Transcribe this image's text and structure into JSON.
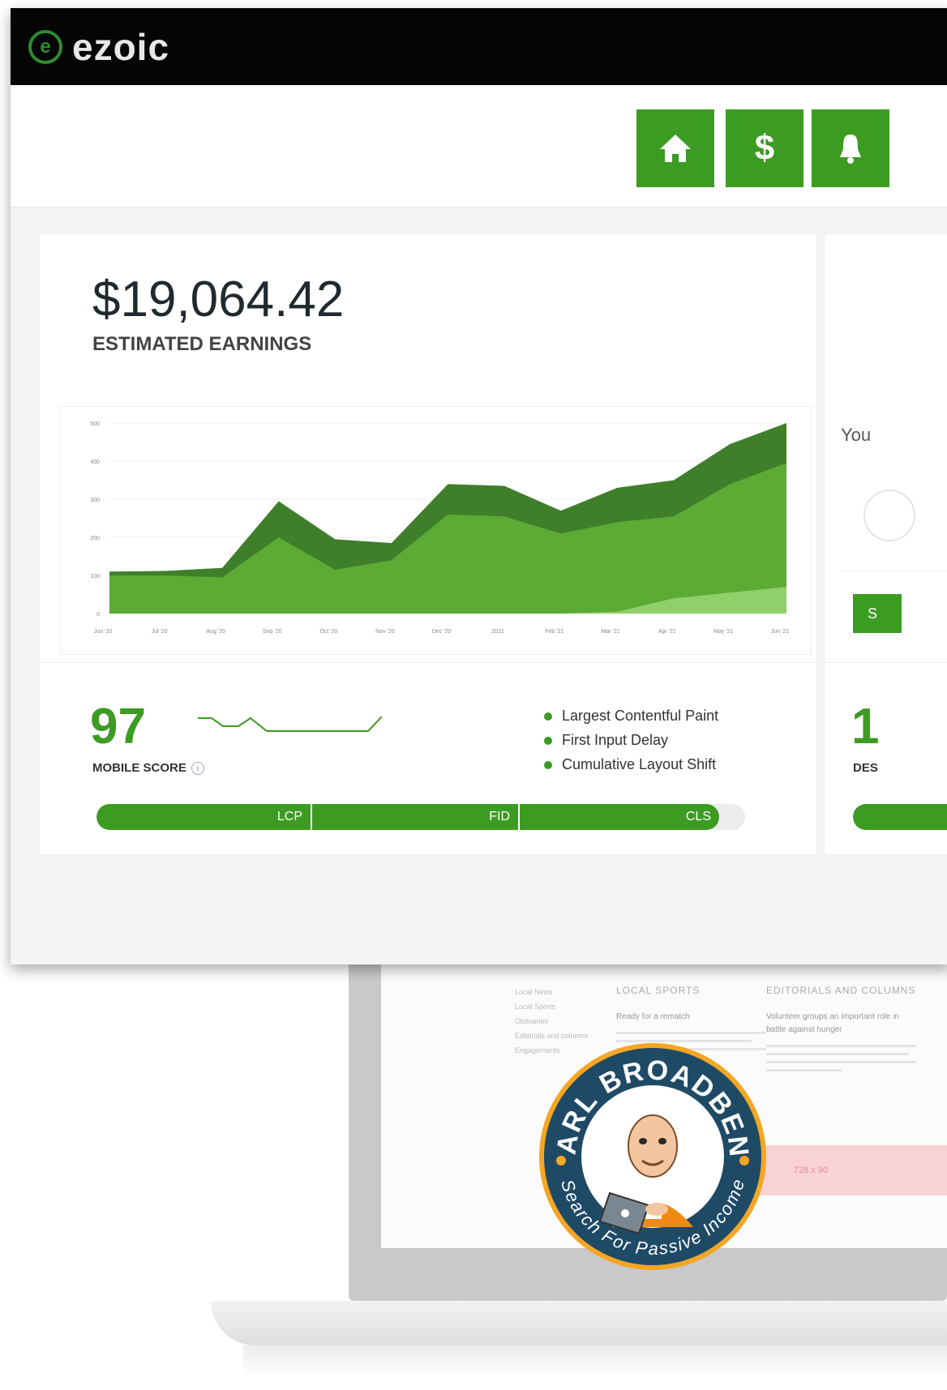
{
  "colors": {
    "accent_green": "#3c9b22",
    "dark_green": "#3f7f2a",
    "topbar": "#050505",
    "ad_pink": "#f8d2d4"
  },
  "app": {
    "logo_text": "ezoic",
    "logo_icon": "ezoic-logo-icon"
  },
  "toolbar": {
    "buttons": [
      {
        "name": "home-button",
        "icon": "home-icon",
        "glyph": "⌂"
      },
      {
        "name": "earnings-button",
        "icon": "dollar-icon",
        "glyph": "$"
      },
      {
        "name": "notifications-button",
        "icon": "bell-icon",
        "glyph": "🔔"
      }
    ]
  },
  "earnings": {
    "value": "$19,064.42",
    "label": "ESTIMATED EARNINGS"
  },
  "chart_data": {
    "type": "area",
    "x": [
      "Jun '20",
      "Jul '20",
      "Aug '20",
      "Sep '20",
      "Oct '20",
      "Nov '20",
      "Dec '20",
      "2021",
      "Feb '21",
      "Mar '21",
      "Apr '21",
      "May '21",
      "Jun '21"
    ],
    "yticks": [
      "0",
      "100",
      "200",
      "300",
      "400",
      "500"
    ],
    "ylim": [
      0,
      500
    ],
    "series": [
      {
        "values": [
          110,
          112,
          120,
          295,
          195,
          185,
          340,
          335,
          270,
          330,
          350,
          445,
          500
        ]
      },
      {
        "values": [
          100,
          100,
          95,
          200,
          115,
          140,
          260,
          255,
          210,
          240,
          255,
          340,
          395
        ]
      },
      {
        "values": [
          0,
          0,
          0,
          0,
          0,
          0,
          0,
          0,
          0,
          5,
          40,
          55,
          70
        ]
      }
    ]
  },
  "mobile": {
    "score": "97",
    "label": "MOBILE SCORE",
    "legend": [
      "Largest Contentful Paint",
      "First Input Delay",
      "Cumulative Layout Shift"
    ],
    "bar": [
      {
        "label": "LCP",
        "fraction": 0.33
      },
      {
        "label": "FID",
        "fraction": 0.32
      },
      {
        "label": "CLS",
        "fraction": 0.31
      }
    ]
  },
  "side_panel": {
    "text": "You",
    "button_text": "S",
    "score_partial": "1",
    "label_partial": "DES"
  },
  "background_page": {
    "nav": [
      "Local News",
      "Local Sports",
      "Obituaries",
      "Editorials and columns",
      "Engagements"
    ],
    "columns": [
      {
        "heading": "LOCAL SPORTS",
        "headline": "Ready for a rematch"
      },
      {
        "heading": "EDITORIALS AND COLUMNS",
        "headline": "Volunteer groups an important role in battle against hunger"
      }
    ],
    "ad_label": "728 x 90"
  },
  "badge": {
    "top_text": "CARL BROADBENT",
    "bottom_text": "Search For Passive Income"
  }
}
